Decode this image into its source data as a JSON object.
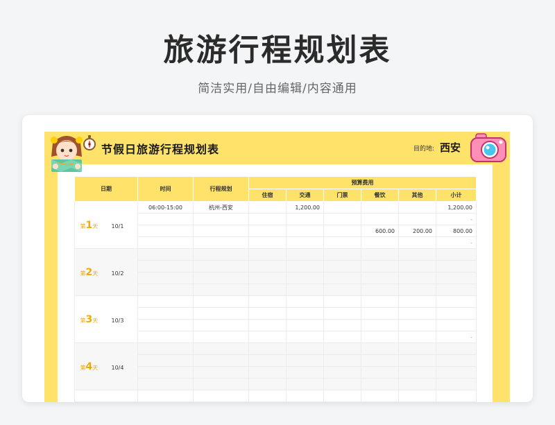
{
  "header": {
    "title": "旅游行程规划表",
    "subtitle": "简洁实用/自由编辑/内容通用"
  },
  "sheet": {
    "title": "节假日旅游行程规划表",
    "destination_label": "目的地:",
    "destination": "西安"
  },
  "table": {
    "headers": {
      "date": "日期",
      "time": "时间",
      "plan": "行程规划",
      "budget": "预算费用",
      "lodging": "住宿",
      "transport": "交通",
      "tickets": "门票",
      "dining": "餐饮",
      "other": "其他",
      "subtotal": "小计"
    },
    "days": [
      {
        "prefix": "第",
        "num": "1",
        "suffix": "天",
        "date": "10/1",
        "rows": [
          {
            "time": "06:00-15:00",
            "plan": "杭州-西安",
            "lodging": "",
            "transport": "1,200.00",
            "tickets": "",
            "dining": "",
            "other": "",
            "subtotal": "1,200.00"
          },
          {
            "time": "",
            "plan": "",
            "lodging": "",
            "transport": "",
            "tickets": "",
            "dining": "",
            "other": "",
            "subtotal": "-"
          },
          {
            "time": "",
            "plan": "",
            "lodging": "",
            "transport": "",
            "tickets": "",
            "dining": "600.00",
            "other": "200.00",
            "subtotal": "800.00"
          },
          {
            "time": "",
            "plan": "",
            "lodging": "",
            "transport": "",
            "tickets": "",
            "dining": "",
            "other": "",
            "subtotal": "-"
          }
        ]
      },
      {
        "prefix": "第",
        "num": "2",
        "suffix": "天",
        "date": "10/2",
        "rows": [
          {
            "time": "",
            "plan": "",
            "lodging": "",
            "transport": "",
            "tickets": "",
            "dining": "",
            "other": "",
            "subtotal": ""
          },
          {
            "time": "",
            "plan": "",
            "lodging": "",
            "transport": "",
            "tickets": "",
            "dining": "",
            "other": "",
            "subtotal": ""
          },
          {
            "time": "",
            "plan": "",
            "lodging": "",
            "transport": "",
            "tickets": "",
            "dining": "",
            "other": "",
            "subtotal": ""
          },
          {
            "time": "",
            "plan": "",
            "lodging": "",
            "transport": "",
            "tickets": "",
            "dining": "",
            "other": "",
            "subtotal": ""
          }
        ]
      },
      {
        "prefix": "第",
        "num": "3",
        "suffix": "天",
        "date": "10/3",
        "rows": [
          {
            "time": "",
            "plan": "",
            "lodging": "",
            "transport": "",
            "tickets": "",
            "dining": "",
            "other": "",
            "subtotal": ""
          },
          {
            "time": "",
            "plan": "",
            "lodging": "",
            "transport": "",
            "tickets": "",
            "dining": "",
            "other": "",
            "subtotal": ""
          },
          {
            "time": "",
            "plan": "",
            "lodging": "",
            "transport": "",
            "tickets": "",
            "dining": "",
            "other": "",
            "subtotal": ""
          },
          {
            "time": "",
            "plan": "",
            "lodging": "",
            "transport": "",
            "tickets": "",
            "dining": "",
            "other": "",
            "subtotal": "-"
          }
        ]
      },
      {
        "prefix": "第",
        "num": "4",
        "suffix": "天",
        "date": "10/4",
        "rows": [
          {
            "time": "",
            "plan": "",
            "lodging": "",
            "transport": "",
            "tickets": "",
            "dining": "",
            "other": "",
            "subtotal": ""
          },
          {
            "time": "",
            "plan": "",
            "lodging": "",
            "transport": "",
            "tickets": "",
            "dining": "",
            "other": "",
            "subtotal": ""
          },
          {
            "time": "",
            "plan": "",
            "lodging": "",
            "transport": "",
            "tickets": "",
            "dining": "",
            "other": "",
            "subtotal": ""
          },
          {
            "time": "",
            "plan": "",
            "lodging": "",
            "transport": "",
            "tickets": "",
            "dining": "",
            "other": "",
            "subtotal": ""
          }
        ]
      },
      {
        "prefix": "",
        "num": "",
        "suffix": "",
        "date": "",
        "rows": [
          {
            "time": "",
            "plan": "",
            "lodging": "",
            "transport": "",
            "tickets": "",
            "dining": "",
            "other": "",
            "subtotal": ""
          }
        ]
      }
    ]
  },
  "icons": {
    "girl": "girl-with-map-icon",
    "compass": "compass-icon",
    "camera": "camera-icon"
  },
  "colors": {
    "background": "#f4f5f7",
    "sheet_yellow": "#ffe26a",
    "day_label": "#f2a900",
    "camera_pink": "#ff8fb6",
    "camera_lens": "#47c7f0"
  }
}
